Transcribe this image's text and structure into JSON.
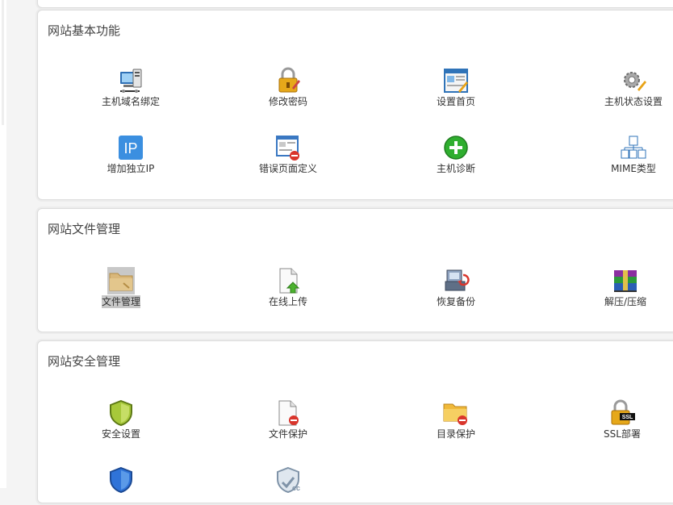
{
  "sections": {
    "basic": {
      "title": "网站基本功能",
      "items": [
        {
          "label": "主机域名绑定",
          "icon": "domain-binding-icon"
        },
        {
          "label": "修改密码",
          "icon": "lock-icon"
        },
        {
          "label": "设置首页",
          "icon": "homepage-icon"
        },
        {
          "label": "主机状态设置",
          "icon": "gear-icon"
        },
        {
          "label": "增加独立IP",
          "icon": "ip-icon"
        },
        {
          "label": "错误页面定义",
          "icon": "error-page-icon"
        },
        {
          "label": "主机诊断",
          "icon": "diagnose-icon"
        },
        {
          "label": "MIME类型",
          "icon": "mime-icon"
        }
      ]
    },
    "files": {
      "title": "网站文件管理",
      "items": [
        {
          "label": "文件管理",
          "icon": "folder-icon"
        },
        {
          "label": "在线上传",
          "icon": "upload-icon"
        },
        {
          "label": "恢复备份",
          "icon": "restore-icon"
        },
        {
          "label": "解压/压缩",
          "icon": "archive-icon"
        }
      ]
    },
    "security": {
      "title": "网站安全管理",
      "items": [
        {
          "label": "安全设置",
          "icon": "shield-icon"
        },
        {
          "label": "文件保护",
          "icon": "file-protect-icon"
        },
        {
          "label": "目录保护",
          "icon": "folder-protect-icon"
        },
        {
          "label": "SSL部署",
          "icon": "ssl-lock-icon"
        },
        {
          "label": "",
          "icon": "blue-shield-icon"
        },
        {
          "label": "",
          "icon": "cc-shield-icon"
        }
      ]
    }
  },
  "colors": {
    "panel_border": "#dcdcdc",
    "selected_bg": "#c8c8c8",
    "page_bg": "#f4f4f4"
  }
}
